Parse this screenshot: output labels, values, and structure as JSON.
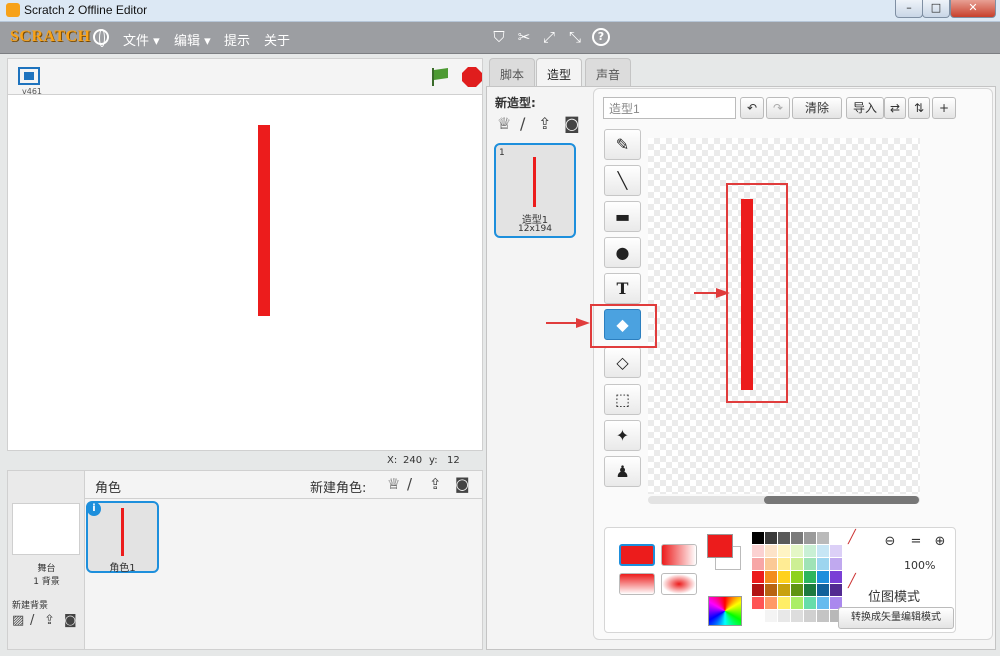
{
  "window": {
    "title": "Scratch 2 Offline Editor",
    "min": "–",
    "max": "□",
    "close": "✕"
  },
  "menu": {
    "logo": "SCRATCH",
    "file": "文件 ▾",
    "edit": "编辑 ▾",
    "tips": "提示",
    "about": "关于",
    "icons": [
      "duplicate-icon",
      "delete-icon",
      "grow-icon",
      "shrink-icon",
      "help-icon"
    ]
  },
  "stage": {
    "version": "v461",
    "x_label": "X:",
    "x_value": "240",
    "y_label": "y:",
    "y_value": "12"
  },
  "sprites": {
    "header": "角色",
    "new_sprite": "新建角色:",
    "stage_label": "舞台",
    "backdrop_count": "1 背景",
    "new_backdrop": "新建背景",
    "sprite_name": "角色1"
  },
  "tabs": [
    "脚本",
    "造型",
    "声音"
  ],
  "costumes": {
    "new_costume": "新造型:",
    "index": "1",
    "name": "造型1",
    "size": "12x194"
  },
  "paint": {
    "name_value": "造型1",
    "clear": "清除",
    "import": "导入",
    "zoom": "100%",
    "mode_title": "位图模式",
    "convert": "转换成矢量编辑模式"
  },
  "colors": {
    "fill": "#ec1c1c",
    "accent": "#1d8fdc",
    "arrow": "#e03c3c",
    "palette": [
      "#000000",
      "#3a3a3a",
      "#5a5a5a",
      "#7a7a7a",
      "#9a9a9a",
      "#bababa",
      "#ffffff",
      "#fbd1d1",
      "#fde3c8",
      "#fff4c4",
      "#e4f7c6",
      "#c9f0d5",
      "#c7e6f5",
      "#dcd0f7",
      "#f7a6a6",
      "#fbc996",
      "#ffec94",
      "#cdef94",
      "#9fe3b6",
      "#9dd5ef",
      "#c0a9ef",
      "#ec1c1c",
      "#f28c1c",
      "#ffd11c",
      "#8ed21c",
      "#2db55d",
      "#1d8fdc",
      "#7a3fd6",
      "#b21414",
      "#b86412",
      "#c9a20e",
      "#5f9412",
      "#1c7a3e",
      "#11609a",
      "#522a91",
      "#ff5555",
      "#ff9966",
      "#ffee66",
      "#aaee66",
      "#66ddaa",
      "#66bbee",
      "#aa88ee",
      "#ffffff",
      "#f4f4f4",
      "#e8e8e8",
      "#dddddd",
      "#d0d0d0",
      "#c4c4c4",
      "#b8b8b8"
    ]
  }
}
